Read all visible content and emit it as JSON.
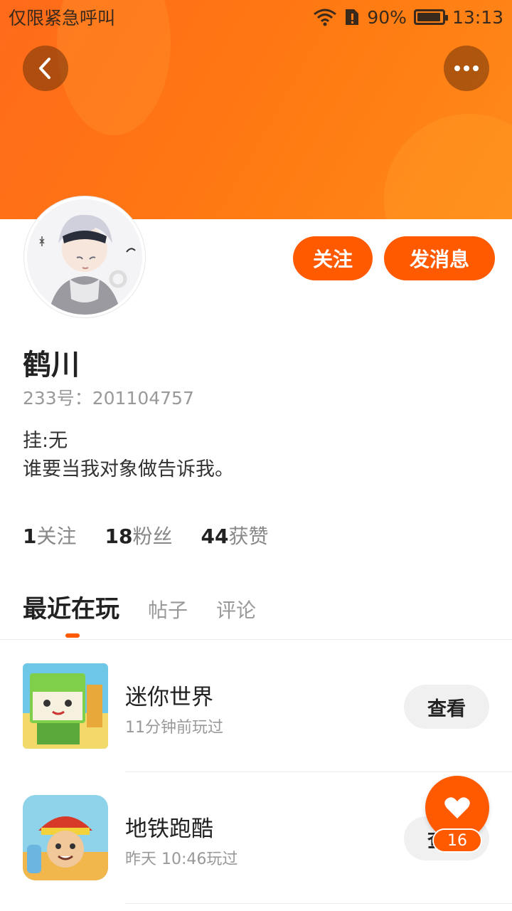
{
  "status_bar": {
    "carrier": "仅限紧急呼叫",
    "battery": "90%",
    "time": "13:13"
  },
  "profile": {
    "name": "鹤川",
    "uid": "233号：201104757",
    "bio_line1": "挂:无",
    "bio_line2": "谁要当我对象做告诉我。",
    "follow_label": "关注",
    "message_label": "发消息"
  },
  "stats": [
    {
      "num": "1",
      "label": "关注"
    },
    {
      "num": "18",
      "label": "粉丝"
    },
    {
      "num": "44",
      "label": "获赞"
    }
  ],
  "tabs": [
    {
      "label": "最近在玩"
    },
    {
      "label": "帖子"
    },
    {
      "label": "评论"
    }
  ],
  "games": [
    {
      "title": "迷你世界",
      "subtitle": "11分钟前玩过",
      "button": "查看"
    },
    {
      "title": "地铁跑酷",
      "subtitle": "昨天 10:46玩过",
      "button": "查看"
    }
  ],
  "like_count": "16",
  "colors": {
    "accent": "#ff5a00",
    "header": "#ff7a12"
  },
  "icons": {
    "back": "chevron-left-icon",
    "more": "more-dots-icon",
    "like": "heart-icon"
  }
}
